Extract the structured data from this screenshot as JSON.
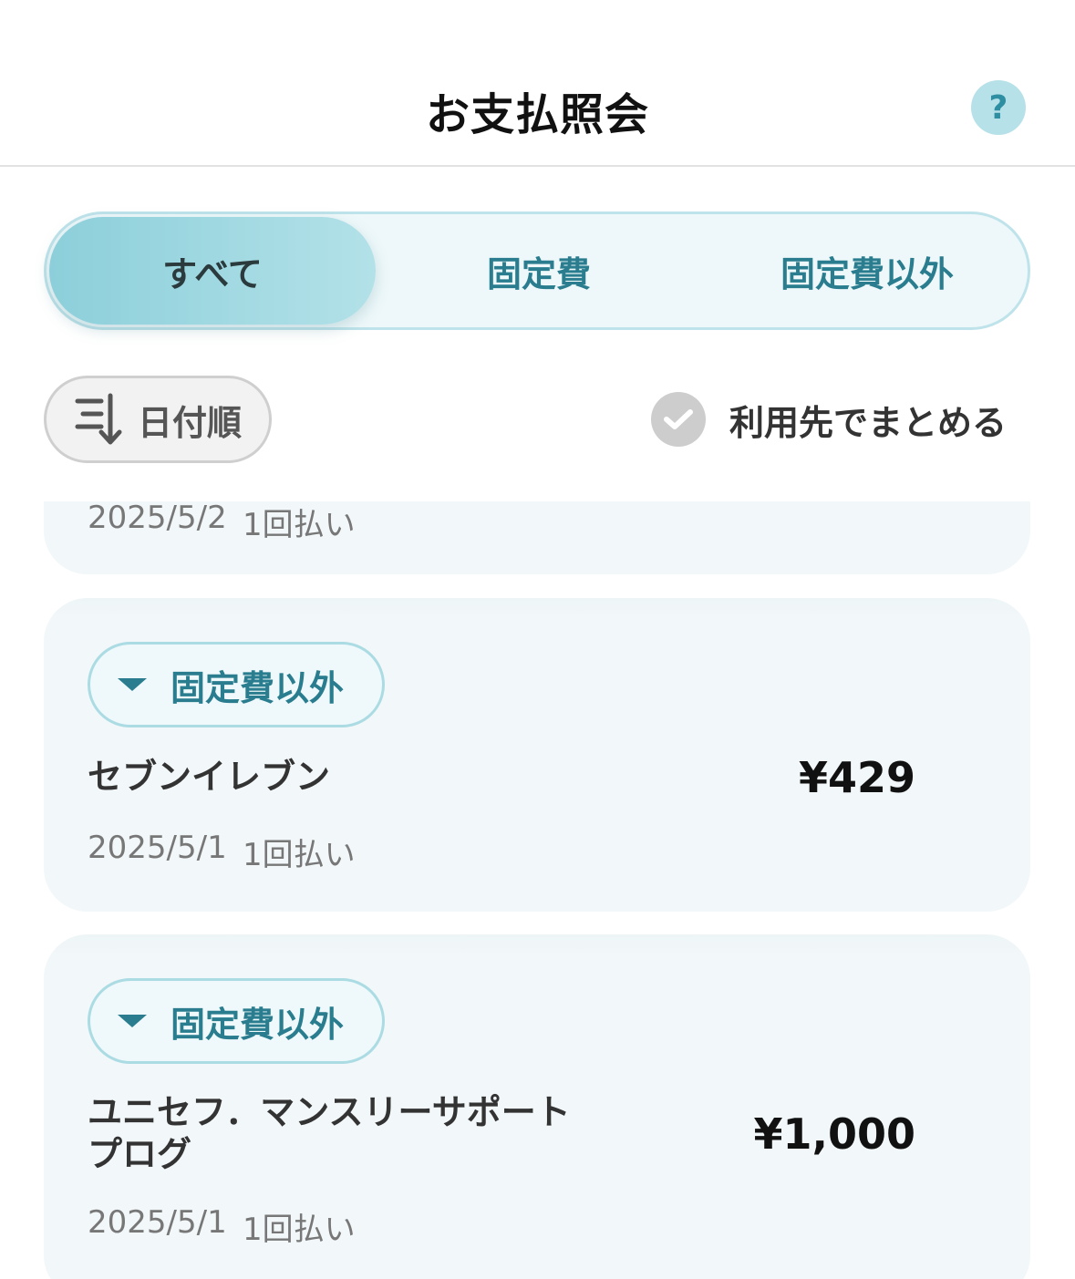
{
  "header": {
    "title": "お支払照会",
    "help_label": "?"
  },
  "tabs": [
    {
      "label": "すべて"
    },
    {
      "label": "固定費"
    },
    {
      "label": "固定費以外"
    }
  ],
  "sort": {
    "label": "日付順"
  },
  "group": {
    "label": "利用先でまとめる"
  },
  "payments": [
    {
      "date": "2025/5/2",
      "installment": "1回払い"
    },
    {
      "category": "固定費以外",
      "merchant": "セブンイレブン",
      "amount": "¥429",
      "date": "2025/5/1",
      "installment": "1回払い"
    },
    {
      "category": "固定費以外",
      "merchant": "ユニセフ．マンスリーサポートプログ",
      "amount": "¥1,000",
      "date": "2025/5/1",
      "installment": "1回払い"
    }
  ]
}
